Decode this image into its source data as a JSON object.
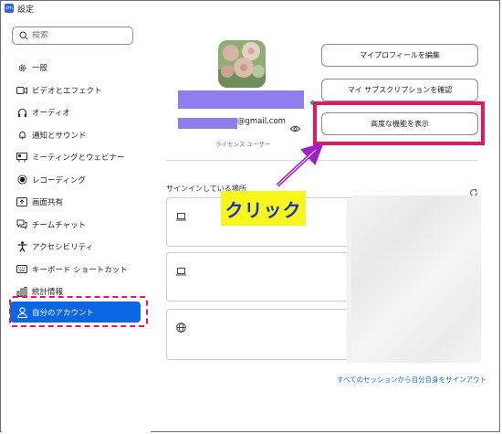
{
  "window": {
    "title": "設定",
    "app_icon_text": "zm"
  },
  "search": {
    "placeholder": "検索"
  },
  "sidebar": {
    "items": [
      {
        "label": "一般",
        "icon": "gear-icon"
      },
      {
        "label": "ビデオとエフェクト",
        "icon": "video-camera-icon"
      },
      {
        "label": "オーディオ",
        "icon": "headphones-icon"
      },
      {
        "label": "通知とサウンド",
        "icon": "bell-icon"
      },
      {
        "label": "ミーティングとウェビナー",
        "icon": "meeting-icon"
      },
      {
        "label": "レコーディング",
        "icon": "record-icon"
      },
      {
        "label": "画面共有",
        "icon": "screen-share-icon"
      },
      {
        "label": "チームチャット",
        "icon": "chat-icon"
      },
      {
        "label": "アクセシビリティ",
        "icon": "accessibility-icon"
      },
      {
        "label": "キーボード ショートカット",
        "icon": "keyboard-icon"
      },
      {
        "label": "統計情報",
        "icon": "stats-icon"
      },
      {
        "label": "自分のアカウント",
        "icon": "user-icon",
        "active": true
      }
    ]
  },
  "profile": {
    "email_suffix": "@gmail.com",
    "license": "ライセンス ユーザー"
  },
  "buttons": {
    "edit_profile": "マイプロフィールを編集",
    "check_subscription": "マイ サブスクリプションを確認",
    "advanced": "高度な機能を表示"
  },
  "sessions": {
    "label": "サインインしている場所",
    "signout_all": "すべてのセッションから自分自身をサインアウト"
  },
  "annotation": {
    "callout": "クリック"
  },
  "colors": {
    "accent": "#0b66e4",
    "highlight": "#e8165d",
    "callout_bg": "#f8f61c",
    "callout_text": "#1c2fd0",
    "redaction": "#8f7ef0"
  }
}
